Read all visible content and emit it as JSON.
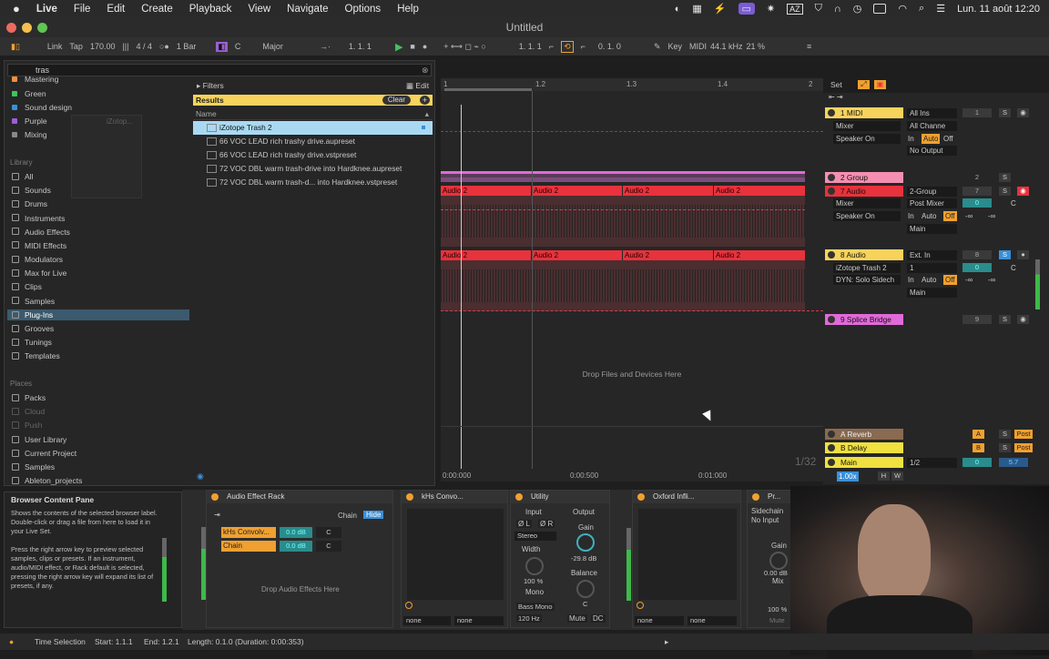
{
  "menubar": {
    "apple": "",
    "app": "Live",
    "items": [
      "File",
      "Edit",
      "Create",
      "Playback",
      "View",
      "Navigate",
      "Options",
      "Help"
    ],
    "clock": "Lun. 11 août  12:20",
    "battery": ""
  },
  "window": {
    "title": "Untitled"
  },
  "control": {
    "link": "Link",
    "tap": "Tap",
    "tempo": "170.00",
    "sig": "4 / 4",
    "quant": "1 Bar",
    "key": "C",
    "scale": "Major",
    "pos1": "1.   1.   1",
    "pos2": "1.   1.   1",
    "pos3": "0.   1.   0",
    "key_label": "Key",
    "midi_label": "MIDI",
    "sample_rate": "44.1 kHz",
    "cpu": "21 %"
  },
  "browser": {
    "search": "tras",
    "collections": [
      {
        "label": "Mastering",
        "color": "#f09040"
      },
      {
        "label": "Green",
        "color": "#3fc35c"
      },
      {
        "label": "Sound design",
        "color": "#3a8fd8"
      },
      {
        "label": "Purple",
        "color": "#9b5fd0"
      },
      {
        "label": "Mixing",
        "color": "#888888"
      }
    ],
    "library_head": "Library",
    "library": [
      "All",
      "Sounds",
      "Drums",
      "Instruments",
      "Audio Effects",
      "MIDI Effects",
      "Modulators",
      "Max for Live",
      "Clips",
      "Samples",
      "Plug-Ins",
      "Grooves",
      "Tunings",
      "Templates"
    ],
    "places_head": "Places",
    "places": [
      "Packs",
      "Cloud",
      "Push",
      "User Library",
      "Current Project",
      "Samples",
      "Ableton_projects"
    ],
    "filters": "Filters",
    "edit": "Edit",
    "results": "Results",
    "clear": "Clear",
    "name_col": "Name",
    "rows": [
      "iZotope Trash 2",
      "66 VOC LEAD rich trashy drive.aupreset",
      "66 VOC LEAD rich trashy drive.vstpreset",
      "72 VOC DBL warm trash-drive into Hardknee.aupreset",
      "72 VOC DBL warm trash-d... into Hardknee.vstpreset"
    ],
    "ghost": "iZotop..."
  },
  "info": {
    "title": "Browser Content Pane",
    "desc": "Shows the contents of the selected browser label. Double-click or drag a file from here to load it in your Live Set.\n\nPress the right arrow key to preview selected samples, clips or presets. If an instrument, audio/MIDI effect, or Rack default is selected, pressing the right arrow key will expand its list of presets, if any."
  },
  "arrangement": {
    "ruler": [
      "1",
      "1.2",
      "1.3",
      "1.4",
      "2"
    ],
    "clip_label": "Audio 2",
    "drop": "Drop Files and Devices Here",
    "time": [
      "0:00:000",
      "0:00:500",
      "0:01:000"
    ],
    "set": "Set",
    "zoom": "1/32"
  },
  "tracks": [
    {
      "name": "1 MIDI",
      "color": "#f7d35c",
      "in": "All Ins",
      "ch": "All Channe",
      "mon": "Mixer",
      "out": "Speaker On",
      "route": "No Output",
      "num": "1"
    },
    {
      "name": "2 Group",
      "color": "#f48fb1",
      "num": "2"
    },
    {
      "name": "7 Audio",
      "color": "#e8323c",
      "in": "2-Group",
      "mon": "Mixer",
      "out": "Speaker On",
      "post": "Post Mixer",
      "route": "Main",
      "num": "7"
    },
    {
      "name": "8 Audio",
      "color": "#f7d35c",
      "in": "Ext. In",
      "dev": "iZotope Trash 2",
      "ch": "1",
      "out": "DYN: Solo Sidech",
      "route": "Main",
      "num": "8"
    },
    {
      "name": "9 Splice Bridge",
      "color": "#e06ad8",
      "num": "9"
    },
    {
      "name": "A Reverb",
      "color": "#e0a070",
      "letter": "A"
    },
    {
      "name": "B Delay",
      "color": "#f0e040",
      "letter": "B"
    },
    {
      "name": "Main",
      "color": "#f0e040",
      "ratio": "1/2",
      "vol": "5.7",
      "speed": "1.00x"
    }
  ],
  "mixer_labels": {
    "in": "In",
    "auto": "Auto",
    "off": "Off",
    "c": "C",
    "s": "S",
    "post": "Post",
    "inf": "-∞",
    "zero": "0",
    "h": "H",
    "w": "W"
  },
  "devices": {
    "rack": {
      "title": "Audio Effect Rack",
      "chain": "Chain",
      "hide": "Hide",
      "chains": [
        {
          "name": "kHs Convolv...",
          "vol": "0.0 dB"
        },
        {
          "name": "Chain",
          "vol": "0.0 dB"
        }
      ],
      "drop": "Drop Audio Effects Here",
      "pan": "C"
    },
    "khs": {
      "title": "kHs Convo..."
    },
    "utility": {
      "title": "Utility",
      "input": "Input",
      "output": "Output",
      "l": "Ø L",
      "r": "Ø R",
      "stereo": "Stereo",
      "width": "Width",
      "width_val": "100 %",
      "mono": "Mono",
      "bass": "Bass Mono",
      "bass_freq": "120 Hz",
      "gain": "Gain",
      "gain_val": "-29.8 dB",
      "balance": "Balance",
      "balance_val": "C",
      "mute": "Mute",
      "dc": "DC"
    },
    "oxford": {
      "title": "Oxford Infli..."
    },
    "last": {
      "title": "Pr...",
      "sidechain": "Sidechain",
      "noinput": "No Input",
      "gain": "Gain",
      "gain_val": "0.00 dB",
      "mix": "Mix",
      "mix_val": "100 %",
      "mute": "Mute"
    },
    "none": "none"
  },
  "status": {
    "mode": "Time Selection",
    "start": "Start: 1.1.1",
    "end": "End: 1.2.1",
    "length": "Length: 0.1.0  (Duration: 0:00:353)"
  }
}
